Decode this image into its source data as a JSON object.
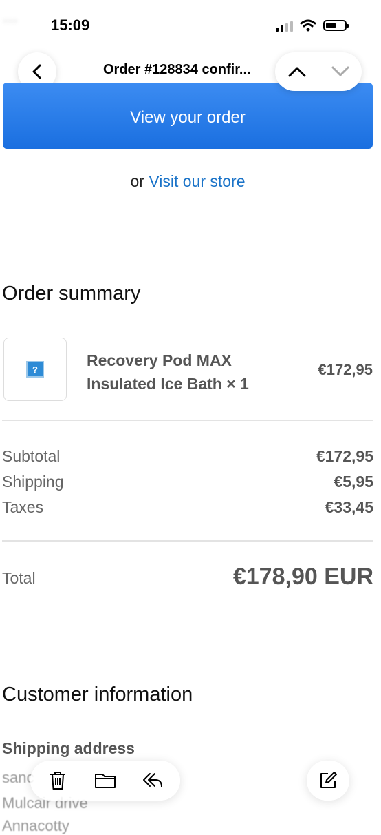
{
  "background_text": "...",
  "status_bar": {
    "time": "15:09"
  },
  "nav": {
    "title": "Order #128834 confir..."
  },
  "cta": {
    "view_order_label": "View your order"
  },
  "store": {
    "prefix": "or",
    "link": "Visit our store"
  },
  "order_summary": {
    "title": "Order summary",
    "item": {
      "name_line1": "Recovery Pod MAX",
      "name_line2": "Insulated Ice Bath × 1",
      "price": "€172,95"
    },
    "rows": [
      {
        "label": "Subtotal",
        "value": "€172,95"
      },
      {
        "label": "Shipping",
        "value": "€5,95"
      },
      {
        "label": "Taxes",
        "value": "€33,45"
      }
    ],
    "total_label": "Total",
    "total_value": "€178,90 EUR"
  },
  "customer_info": {
    "title": "Customer information",
    "shipping_address_label": "Shipping address",
    "address_lines": [
      "sanc",
      "Mulcair drive",
      "Annacotty"
    ]
  },
  "colors": {
    "accent": "#1a73c8",
    "button": "#2b7de9"
  },
  "toolbar": {
    "icons": [
      "trash-icon",
      "folder-icon",
      "reply-icon",
      "compose-icon"
    ]
  }
}
